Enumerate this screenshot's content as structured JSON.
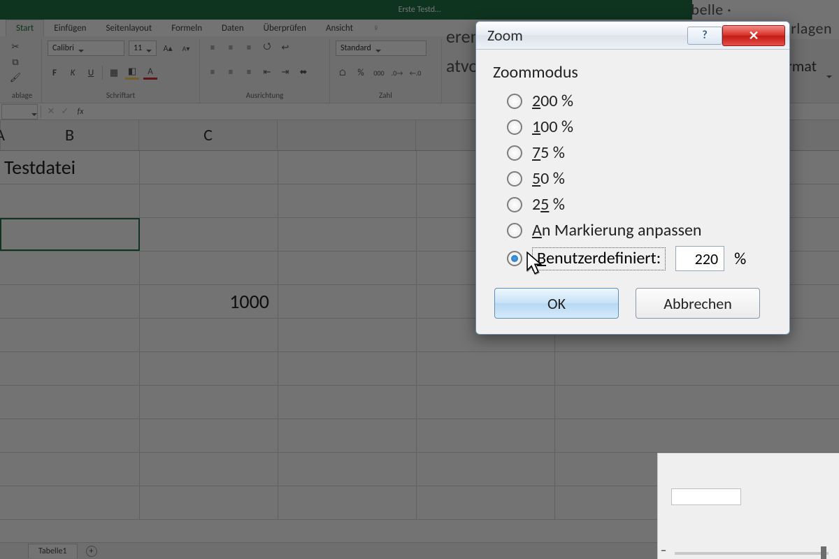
{
  "window": {
    "title": "Erste Testd…"
  },
  "ribbon": {
    "tabs": [
      "Start",
      "Einfügen",
      "Seitenlayout",
      "Formeln",
      "Daten",
      "Überprüfen",
      "Ansicht"
    ],
    "font": {
      "name": "Calibri",
      "size": "11"
    },
    "number_format": "Standard",
    "groups": {
      "clipboard": "ablage",
      "font": "Schriftart",
      "alignment": "Ausrichtung",
      "number": "Zahl"
    }
  },
  "east_fragment": {
    "line1": "belle · Zellenformatvorlagen ·",
    "format": "Format"
  },
  "formula_bar": {
    "fx": "fx"
  },
  "sheet": {
    "columns": [
      "A",
      "B",
      "C"
    ],
    "cells": {
      "A1": "Testdatei",
      "B5": "1000"
    },
    "tab": "Tabelle1"
  },
  "dialog": {
    "title": "Zoom",
    "group": "Zoommodus",
    "options": {
      "p200": "200 %",
      "p100": "100 %",
      "p75": "75 %",
      "p50": "50 %",
      "p25": "25 %",
      "fit": "An Markierung anpassen",
      "custom": "Benutzerdefiniert:"
    },
    "custom_value": "220",
    "percent": "%",
    "ok": "OK",
    "cancel": "Abbrechen"
  },
  "behind": {
    "eren": "eren",
    "atvo": "atvo"
  }
}
